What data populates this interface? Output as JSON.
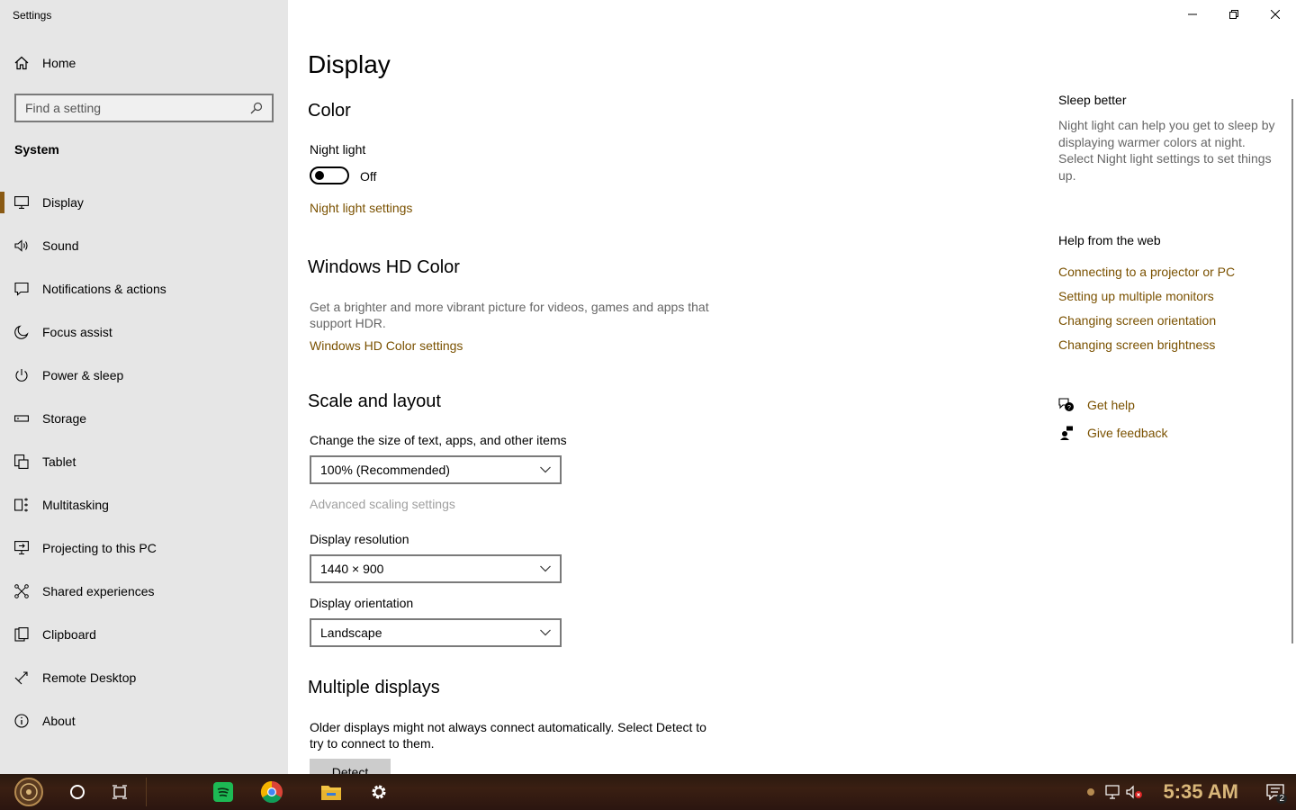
{
  "window": {
    "title": "Settings",
    "controls": [
      "minimize",
      "restore",
      "close"
    ]
  },
  "sidebar": {
    "home_label": "Home",
    "search_placeholder": "Find a setting",
    "section_title": "System",
    "items": [
      {
        "label": "Display",
        "icon": "monitor-icon",
        "active": true
      },
      {
        "label": "Sound",
        "icon": "speaker-icon"
      },
      {
        "label": "Notifications & actions",
        "icon": "message-icon"
      },
      {
        "label": "Focus assist",
        "icon": "moon-icon"
      },
      {
        "label": "Power & sleep",
        "icon": "power-icon"
      },
      {
        "label": "Storage",
        "icon": "drive-icon"
      },
      {
        "label": "Tablet",
        "icon": "tablet-icon"
      },
      {
        "label": "Multitasking",
        "icon": "multitask-icon"
      },
      {
        "label": "Projecting to this PC",
        "icon": "project-icon"
      },
      {
        "label": "Shared experiences",
        "icon": "share-icon"
      },
      {
        "label": "Clipboard",
        "icon": "clipboard-icon"
      },
      {
        "label": "Remote Desktop",
        "icon": "remote-icon"
      },
      {
        "label": "About",
        "icon": "info-icon"
      }
    ]
  },
  "main": {
    "page_title": "Display",
    "color": {
      "heading": "Color",
      "night_light_label": "Night light",
      "night_light_state": "Off",
      "night_light_settings_link": "Night light settings"
    },
    "hd_color": {
      "heading": "Windows HD Color",
      "description": "Get a brighter and more vibrant picture for videos, games and apps that support HDR.",
      "link": "Windows HD Color settings"
    },
    "scale_layout": {
      "heading": "Scale and layout",
      "size_label": "Change the size of text, apps, and other items",
      "size_value": "100% (Recommended)",
      "advanced_link": "Advanced scaling settings",
      "resolution_label": "Display resolution",
      "resolution_value": "1440 × 900",
      "orientation_label": "Display orientation",
      "orientation_value": "Landscape"
    },
    "multiple_displays": {
      "heading": "Multiple displays",
      "description": "Older displays might not always connect automatically. Select Detect to try to connect to them.",
      "detect_button": "Detect"
    }
  },
  "right_panel": {
    "sleep_heading": "Sleep better",
    "sleep_text": "Night light can help you get to sleep by displaying warmer colors at night. Select Night light settings to set things up.",
    "help_heading": "Help from the web",
    "help_links": [
      "Connecting to a projector or PC",
      "Setting up multiple monitors",
      "Changing screen orientation",
      "Changing screen brightness"
    ],
    "get_help": "Get help",
    "give_feedback": "Give feedback"
  },
  "taskbar": {
    "clock": "5:35 AM",
    "notification_count": "2",
    "accent": "#d9b77a"
  },
  "colors": {
    "link": "#7a5100",
    "sidebar_bg": "#e6e6e6",
    "active_indicator": "#8a5a14"
  }
}
